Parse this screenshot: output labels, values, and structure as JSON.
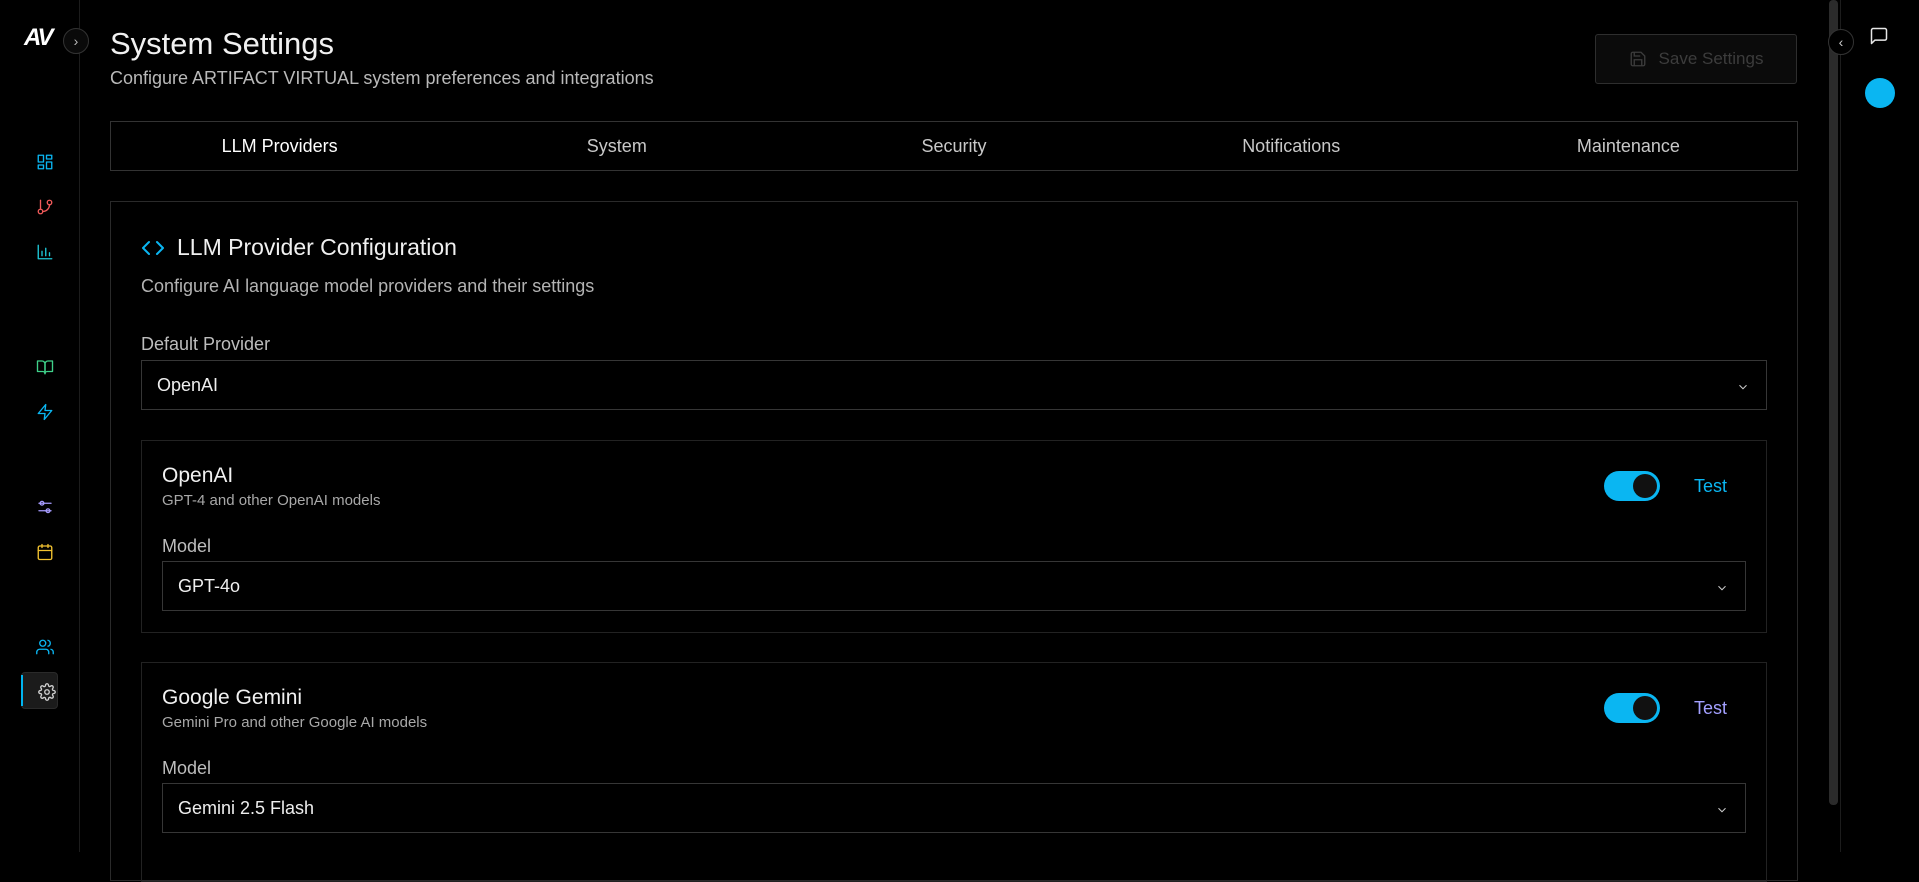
{
  "app": {
    "logo_text": "AV",
    "accent_color": "#0ab6f2"
  },
  "sidebar": {
    "items": [
      {
        "name": "dashboard",
        "icon": "grid-icon",
        "color": "#0ab6f2"
      },
      {
        "name": "workflows",
        "icon": "git-branch-icon",
        "color": "#f05a5a"
      },
      {
        "name": "analytics",
        "icon": "bar-chart-icon",
        "color": "#1ec8d8"
      },
      {
        "name": "docs",
        "icon": "book-open-icon",
        "color": "#3fd18a"
      },
      {
        "name": "actions",
        "icon": "zap-icon",
        "color": "#0ab6f2"
      },
      {
        "name": "controls",
        "icon": "sliders-icon",
        "color": "#a79cff"
      },
      {
        "name": "calendar",
        "icon": "calendar-icon",
        "color": "#f2c230"
      },
      {
        "name": "users",
        "icon": "users-icon",
        "color": "#0ab6f2"
      },
      {
        "name": "settings",
        "icon": "gear-icon",
        "color": "#cfcfcf",
        "active": true
      }
    ]
  },
  "header": {
    "title": "System Settings",
    "subtitle": "Configure ARTIFACT VIRTUAL system preferences and integrations",
    "save_label": "Save Settings"
  },
  "tabs": [
    {
      "label": "LLM Providers",
      "active": true
    },
    {
      "label": "System"
    },
    {
      "label": "Security"
    },
    {
      "label": "Notifications"
    },
    {
      "label": "Maintenance"
    }
  ],
  "llm": {
    "title": "LLM Provider Configuration",
    "subtitle": "Configure AI language model providers and their settings",
    "default_provider_label": "Default Provider",
    "default_provider_value": "OpenAI",
    "providers": [
      {
        "name": "OpenAI",
        "description": "GPT-4 and other OpenAI models",
        "enabled": true,
        "test_label": "Test",
        "model_label": "Model",
        "model_value": "GPT-4o"
      },
      {
        "name": "Google Gemini",
        "description": "Gemini Pro and other Google AI models",
        "enabled": true,
        "test_label": "Test",
        "model_label": "Model",
        "model_value": "Gemini 2.5 Flash"
      }
    ]
  }
}
